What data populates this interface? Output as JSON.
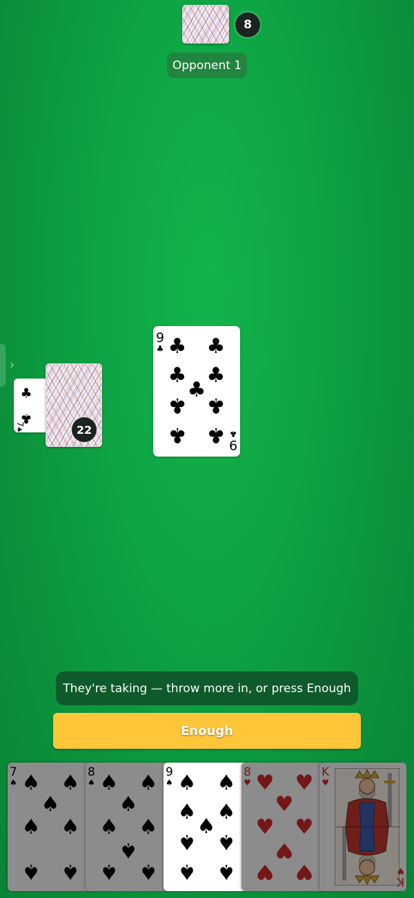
{
  "opponent": {
    "name": "Opponent 1",
    "card_count": "8"
  },
  "deck": {
    "remaining": "22",
    "trump_card": {
      "rank": "7",
      "suit": "♣",
      "color": "black"
    }
  },
  "table_card": {
    "rank": "9",
    "suit": "♣",
    "color": "black"
  },
  "status_message": "They're taking — throw more in, or press Enough",
  "enough_button": {
    "label": "Enough"
  },
  "hand": [
    {
      "rank": "7",
      "suit": "♠",
      "color": "black",
      "playable": false
    },
    {
      "rank": "8",
      "suit": "♠",
      "color": "black",
      "playable": false
    },
    {
      "rank": "9",
      "suit": "♠",
      "color": "black",
      "playable": true
    },
    {
      "rank": "8",
      "suit": "♥",
      "color": "red",
      "playable": false
    },
    {
      "rank": "K",
      "suit": "♥",
      "color": "red",
      "playable": false
    }
  ],
  "colors": {
    "felt": "#0ea544",
    "button": "#ffc63a",
    "status_bg": "#0e5a2b",
    "suit_red": "#d42a2a"
  }
}
